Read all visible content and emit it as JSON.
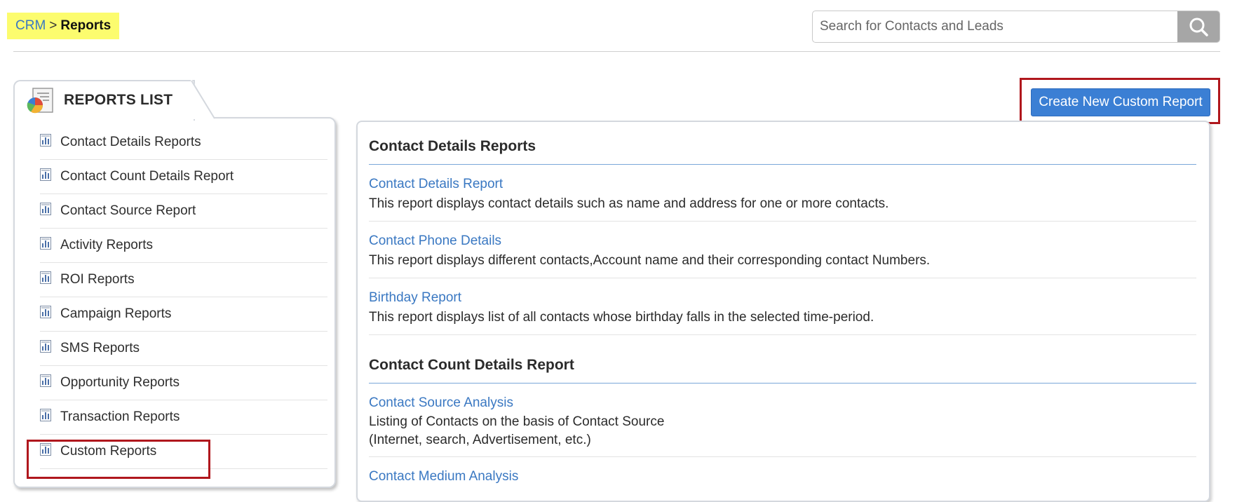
{
  "breadcrumb": {
    "root": "CRM",
    "separator": ">",
    "current": "Reports"
  },
  "search": {
    "placeholder": "Search for Contacts and Leads",
    "icon": "search-icon"
  },
  "reports_list": {
    "title": "REPORTS LIST",
    "items": [
      {
        "label": "Contact Details Reports"
      },
      {
        "label": "Contact Count Details Report"
      },
      {
        "label": "Contact Source Report"
      },
      {
        "label": "Activity Reports"
      },
      {
        "label": "ROI Reports"
      },
      {
        "label": "Campaign Reports"
      },
      {
        "label": "SMS Reports"
      },
      {
        "label": "Opportunity Reports"
      },
      {
        "label": "Transaction Reports"
      },
      {
        "label": "Custom Reports"
      }
    ]
  },
  "create_button": {
    "label": "Create New Custom Report"
  },
  "sections": [
    {
      "heading": "Contact Details Reports",
      "reports": [
        {
          "title": "Contact Details Report",
          "description": "This report displays contact details such as name and address for one or more contacts."
        },
        {
          "title": "Contact Phone Details",
          "description": "This report displays different contacts,Account name and their corresponding contact Numbers."
        },
        {
          "title": "Birthday Report",
          "description": "This report displays list of all contacts whose birthday falls in the selected time-period."
        }
      ]
    },
    {
      "heading": "Contact Count Details Report",
      "reports": [
        {
          "title": "Contact Source Analysis",
          "description": "Listing of Contacts on the basis of Contact Source",
          "description_line2": "(Internet, search, Advertisement, etc.)"
        },
        {
          "title": "Contact Medium Analysis"
        }
      ]
    }
  ],
  "colors": {
    "link": "#3a78c2",
    "button": "#3b7fd4",
    "highlight": "#b0171d",
    "breadcrumb_bg": "#fcfc6e"
  }
}
